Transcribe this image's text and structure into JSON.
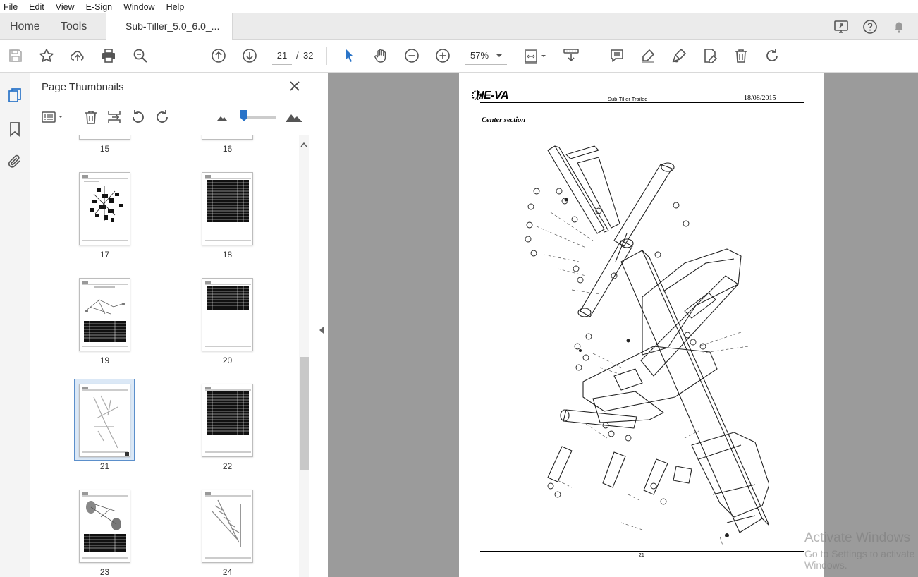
{
  "menu": [
    "File",
    "Edit",
    "View",
    "E-Sign",
    "Window",
    "Help"
  ],
  "nav": {
    "home": "Home",
    "tools": "Tools"
  },
  "doc_tab": {
    "title": "Sub-Tiller_5.0_6.0_..."
  },
  "toolbar": {
    "page_current": "21",
    "page_sep": "/",
    "page_total": "32",
    "zoom": "57%"
  },
  "thumbnails_pane": {
    "title": "Page Thumbnails",
    "pages": [
      {
        "label": "15"
      },
      {
        "label": "16"
      },
      {
        "label": "17"
      },
      {
        "label": "18"
      },
      {
        "label": "19"
      },
      {
        "label": "20"
      },
      {
        "label": "21",
        "selected": true
      },
      {
        "label": "22"
      },
      {
        "label": "23"
      },
      {
        "label": "24"
      }
    ]
  },
  "page": {
    "logo": "HE-VA",
    "header_title": "Sub-Tiller Trailed",
    "header_date": "18/08/2015",
    "section_title": "Center section",
    "footer_page": "21"
  },
  "watermark": {
    "line1": "Activate Windows",
    "line2": "Go to Settings to activate Windows."
  },
  "colors": {
    "accent": "#2a74c8",
    "tabbar": "#ebebeb",
    "doc_bg": "#9b9b9b"
  },
  "icons": [
    "save-icon",
    "star-icon",
    "upload-icon",
    "print-icon",
    "search-zoom-icon",
    "page-up-icon",
    "page-down-icon",
    "select-arrow-icon",
    "hand-icon",
    "zoom-out-icon",
    "zoom-in-icon",
    "fit-page-icon",
    "scroll-mode-icon",
    "comment-icon",
    "highlight-icon",
    "sign-icon",
    "edit-pdf-icon",
    "delete-icon",
    "redo-icon",
    "share-screen-icon",
    "help-icon",
    "bell-icon"
  ]
}
